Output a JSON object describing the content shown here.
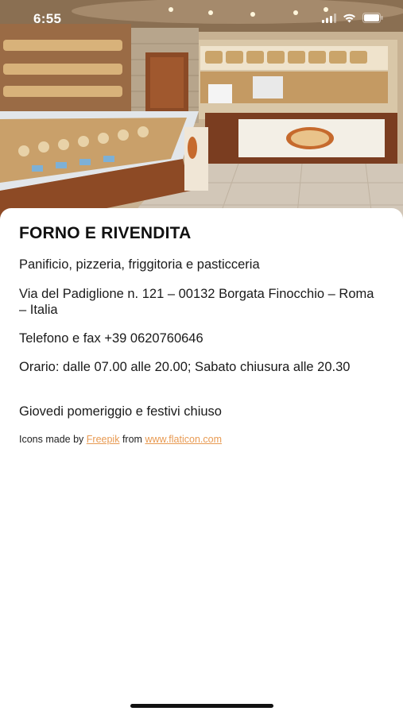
{
  "status_bar": {
    "time": "6:55",
    "icons": [
      "signal-icon",
      "wifi-icon",
      "battery-icon"
    ]
  },
  "hero_image": {
    "subject": "bakery-interior-photo"
  },
  "info": {
    "title": "FORNO E RIVENDITA",
    "description": "Panificio, pizzeria, friggitoria e pasticceria",
    "address": "Via del Padiglione n. 121 – 00132 Borgata Finocchio – Roma – Italia",
    "phone": "Telefono e fax +39 0620760646",
    "hours": "Orario: dalle 07.00 alle 20.00; Sabato chiusura alle 20.30",
    "closed": "Giovedi pomeriggio e festivi chiuso"
  },
  "credit": {
    "prefix": "Icons made by",
    "author_link": "Freepik",
    "middle": "from",
    "site_link": "www.flaticon.com"
  },
  "colors": {
    "link": "#e89a52",
    "text": "#1a1a1a",
    "background": "#ffffff"
  }
}
